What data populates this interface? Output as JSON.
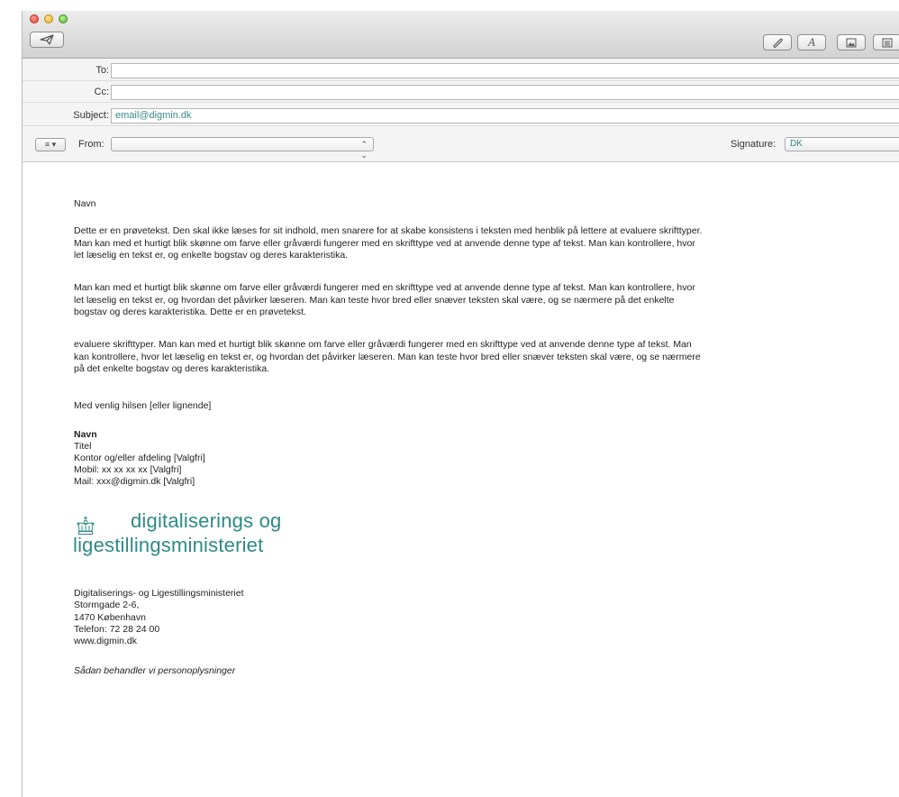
{
  "toolbar": {
    "send_icon": "paper-plane-icon",
    "attach_icon": "paperclip-icon",
    "format_label": "A",
    "photo_icon": "photo-browser-icon",
    "template_icon": "stationery-icon"
  },
  "headers": {
    "to_label": "To:",
    "to_value": "",
    "cc_label": "Cc:",
    "cc_value": "",
    "subject_label": "Subject:",
    "subject_value": "email@digmin.dk",
    "list_button": "≡ ▾",
    "from_label": "From:",
    "from_value": "",
    "signature_label": "Signature:",
    "signature_value": "DK"
  },
  "message": {
    "greeting": "Navn",
    "para1": "Dette er en prøvetekst.  Den skal ikke læses for sit indhold, men snarere for at skabe konsistens i teksten med henblik på lettere at evaluere skrifttyper. Man kan med et hurtigt blik skønne om farve eller gråværdi fungerer med en skrifttype ved at anvende denne type af tekst. Man kan kontrollere, hvor let læselig en tekst er, og enkelte bogstav og deres karakteristika.",
    "para2": "Man kan med et hurtigt blik skønne om farve eller gråværdi fungerer med en skrifttype ved at anvende denne type af tekst. Man kan kontrollere, hvor let læselig en tekst er, og hvordan det påvirker læseren. Man kan teste hvor bred eller snæver teksten skal være, og se nærmere på det enkelte bogstav og deres karakteristika. Dette er en prøvetekst.",
    "para3": "evaluere skrifttyper. Man kan med et hurtigt blik skønne om farve eller gråværdi fungerer med en skrifttype ved at anvende denne type af tekst. Man kan kontrollere, hvor let læselig en tekst er, og hvordan det påvirker læseren. Man kan teste hvor bred eller snæver teksten skal være, og se nærmere på det enkelte bogstav og deres karakteristika.",
    "closing": "Med venlig hilsen [eller lignende]"
  },
  "signature": {
    "name": "Navn",
    "title": "Titel",
    "department": "Kontor og/eller afdeling [Valgfri]",
    "mobile": "Mobil: xx xx xx xx [Valgfri]",
    "mail": "Mail: xxx@digmin.dk [Valgfri]"
  },
  "logo": {
    "line1": "digitaliserings og",
    "line2": "ligestillingsministeriet",
    "color": "#2c8a86",
    "icon": "crown-icon"
  },
  "address": {
    "org": "Digitaliserings- og Ligestillingsministeriet",
    "street": "Stormgade 2-6,",
    "city": "1470 København",
    "phone": "Telefon: 72 28 24 00",
    "web": "www.digmin.dk",
    "privacy": "Sådan behandler vi personoplysninger"
  }
}
